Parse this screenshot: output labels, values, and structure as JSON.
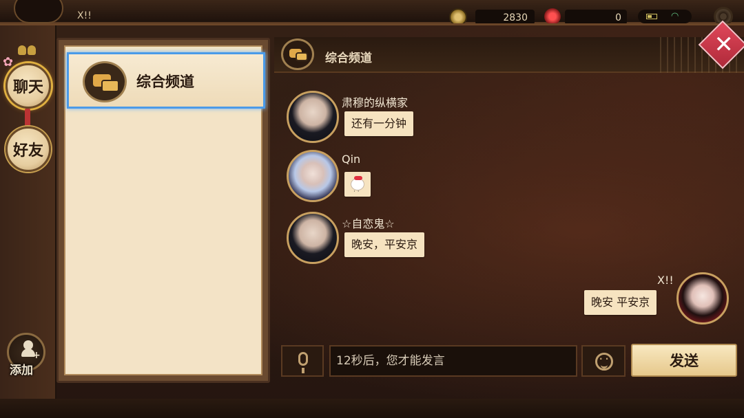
{
  "topbar": {
    "player_name": "X!!",
    "coins": "2830",
    "gems": "0"
  },
  "sidebar": {
    "tabs": [
      {
        "label": "聊天",
        "active": true
      },
      {
        "label": "好友",
        "active": false
      }
    ],
    "add_label": "添加"
  },
  "channels": [
    {
      "label": "综合频道",
      "selected": true
    }
  ],
  "chat": {
    "title": "综合频道",
    "messages": [
      {
        "sender": "肃穆的纵横家",
        "text": "还有一分钟"
      },
      {
        "sender": "Qin",
        "text": "",
        "sticker": "bunny-sticker-icon"
      },
      {
        "sender": "☆自恋鬼☆",
        "text": "晚安，平安京"
      },
      {
        "sender": "X!!",
        "text": "晚安 平安京",
        "self": true
      }
    ]
  },
  "input": {
    "placeholder": "12秒后，您才能发言",
    "send_label": "发送"
  },
  "colors": {
    "bubble": "#f6e3c0",
    "selected_border": "#4a9ae8",
    "close": "#e0475a"
  }
}
